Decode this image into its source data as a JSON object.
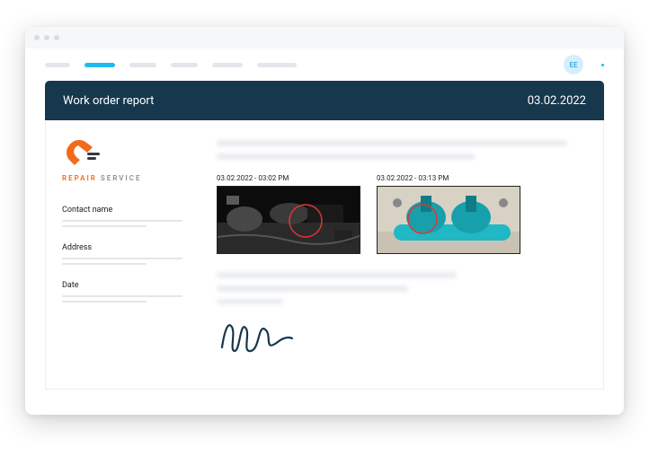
{
  "window": {
    "avatar_initials": "EE"
  },
  "nav": {
    "items_widths": [
      28,
      34,
      30,
      30,
      34,
      44
    ]
  },
  "report": {
    "title": "Work order report",
    "date": "03.02.2022"
  },
  "sidebar": {
    "logo_name_1": "REPAIR",
    "logo_name_2": " SERVICE",
    "fields": [
      {
        "label": "Contact name"
      },
      {
        "label": "Address"
      },
      {
        "label": "Date"
      }
    ]
  },
  "photos": [
    {
      "caption": "03.02.2022 - 03:02 PM",
      "semantic": "engine-photo"
    },
    {
      "caption": "03.02.2022 - 03:13 PM",
      "semantic": "pump-photo"
    }
  ]
}
